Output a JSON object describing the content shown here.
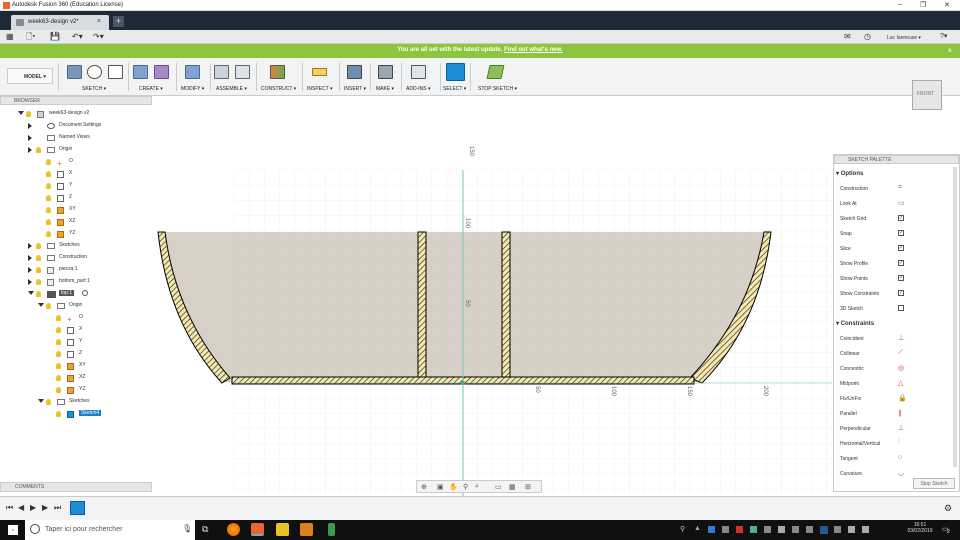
{
  "window": {
    "title": "Autodesk Fusion 360 (Education License)",
    "minimize": "–",
    "maximize": "❐",
    "close": "✕"
  },
  "tab": {
    "label": "week63-design v2*",
    "close": "×",
    "add": "+"
  },
  "qat": {
    "user": "Luc Ianneuse ▾",
    "help": "?▾",
    "grid": "▦",
    "file": "🗋▾",
    "save": "💾",
    "undo": "↶▾",
    "redo": "↷▾",
    "chat": "✉",
    "clock": "◷"
  },
  "notification": {
    "text": "You are all set with the latest update. ",
    "link": "Find out what's new.",
    "close": "×"
  },
  "ribbon": {
    "workspace": "MODEL ▾",
    "groups": [
      "SKETCH ▾",
      "CREATE ▾",
      "MODIFY ▾",
      "ASSEMBLE ▾",
      "CONSTRUCT ▾",
      "INSPECT ▾",
      "INSERT ▾",
      "MAKE ▾",
      "ADD-INS ▾",
      "SELECT ▾",
      "STOP SKETCH ▾"
    ]
  },
  "browser": {
    "title": "BROWSER",
    "nodes": [
      {
        "label": "week63-design v2",
        "depth": 0
      },
      {
        "label": "Document Settings",
        "depth": 1
      },
      {
        "label": "Named Views",
        "depth": 1
      },
      {
        "label": "Origin",
        "depth": 1
      },
      {
        "label": "O",
        "depth": 2
      },
      {
        "label": "X",
        "depth": 2
      },
      {
        "label": "Y",
        "depth": 2
      },
      {
        "label": "Z",
        "depth": 2
      },
      {
        "label": "XY",
        "depth": 2
      },
      {
        "label": "XZ",
        "depth": 2
      },
      {
        "label": "YZ",
        "depth": 2
      },
      {
        "label": "Sketches",
        "depth": 1
      },
      {
        "label": "Construction",
        "depth": 1
      },
      {
        "label": "piecza:1",
        "depth": 1
      },
      {
        "label": "bottom_part:1",
        "depth": 1
      },
      {
        "label": "top:1",
        "depth": 1
      },
      {
        "label": "Origin",
        "depth": 2
      },
      {
        "label": "O",
        "depth": 3
      },
      {
        "label": "X",
        "depth": 3
      },
      {
        "label": "Y",
        "depth": 3
      },
      {
        "label": "Z",
        "depth": 3
      },
      {
        "label": "XY",
        "depth": 3
      },
      {
        "label": "XZ",
        "depth": 3
      },
      {
        "label": "YZ",
        "depth": 3
      },
      {
        "label": "Sketches",
        "depth": 2
      },
      {
        "label": "Sketch4",
        "depth": 3
      }
    ]
  },
  "canvas": {
    "ruler_labels": [
      "150",
      "100",
      "50",
      "50",
      "100",
      "150",
      "200"
    ]
  },
  "viewcube": {
    "label": "FRONT"
  },
  "palette": {
    "title": "SKETCH PALETTE",
    "options_header": "Options",
    "options": [
      {
        "label": "Construction",
        "type": "icon",
        "icon": "⌗"
      },
      {
        "label": "Look At",
        "type": "icon",
        "icon": "▭"
      },
      {
        "label": "Sketch Grid",
        "type": "check",
        "checked": "✓"
      },
      {
        "label": "Snap",
        "type": "check",
        "checked": "✓"
      },
      {
        "label": "Slice",
        "type": "check",
        "checked": "✓"
      },
      {
        "label": "Show Profile",
        "type": "check",
        "checked": "✓"
      },
      {
        "label": "Show Points",
        "type": "check",
        "checked": "✓"
      },
      {
        "label": "Show Constraints",
        "type": "check",
        "checked": "✓"
      },
      {
        "label": "3D Sketch",
        "type": "check",
        "checked": ""
      }
    ],
    "constraints_header": "Constraints",
    "constraints": [
      {
        "label": "Coincident",
        "icon": "⊥"
      },
      {
        "label": "Collinear",
        "icon": "⟋"
      },
      {
        "label": "Concentric",
        "icon": "◎"
      },
      {
        "label": "Midpoint",
        "icon": "△"
      },
      {
        "label": "Fix/UnFix",
        "icon": "🔒"
      },
      {
        "label": "Parallel",
        "icon": "∥"
      },
      {
        "label": "Perpendicular",
        "icon": "⊥"
      },
      {
        "label": "Horizontal/Vertical",
        "icon": "⫶"
      },
      {
        "label": "Tangent",
        "icon": "○"
      },
      {
        "label": "Curvature",
        "icon": "◡"
      }
    ],
    "stop": "Stop Sketch"
  },
  "comments": {
    "title": "COMMENTS"
  },
  "taskbar": {
    "search_placeholder": "Taper ici pour rechercher",
    "time": "16:51",
    "date": "03/02/2019",
    "notif_count": "2"
  }
}
